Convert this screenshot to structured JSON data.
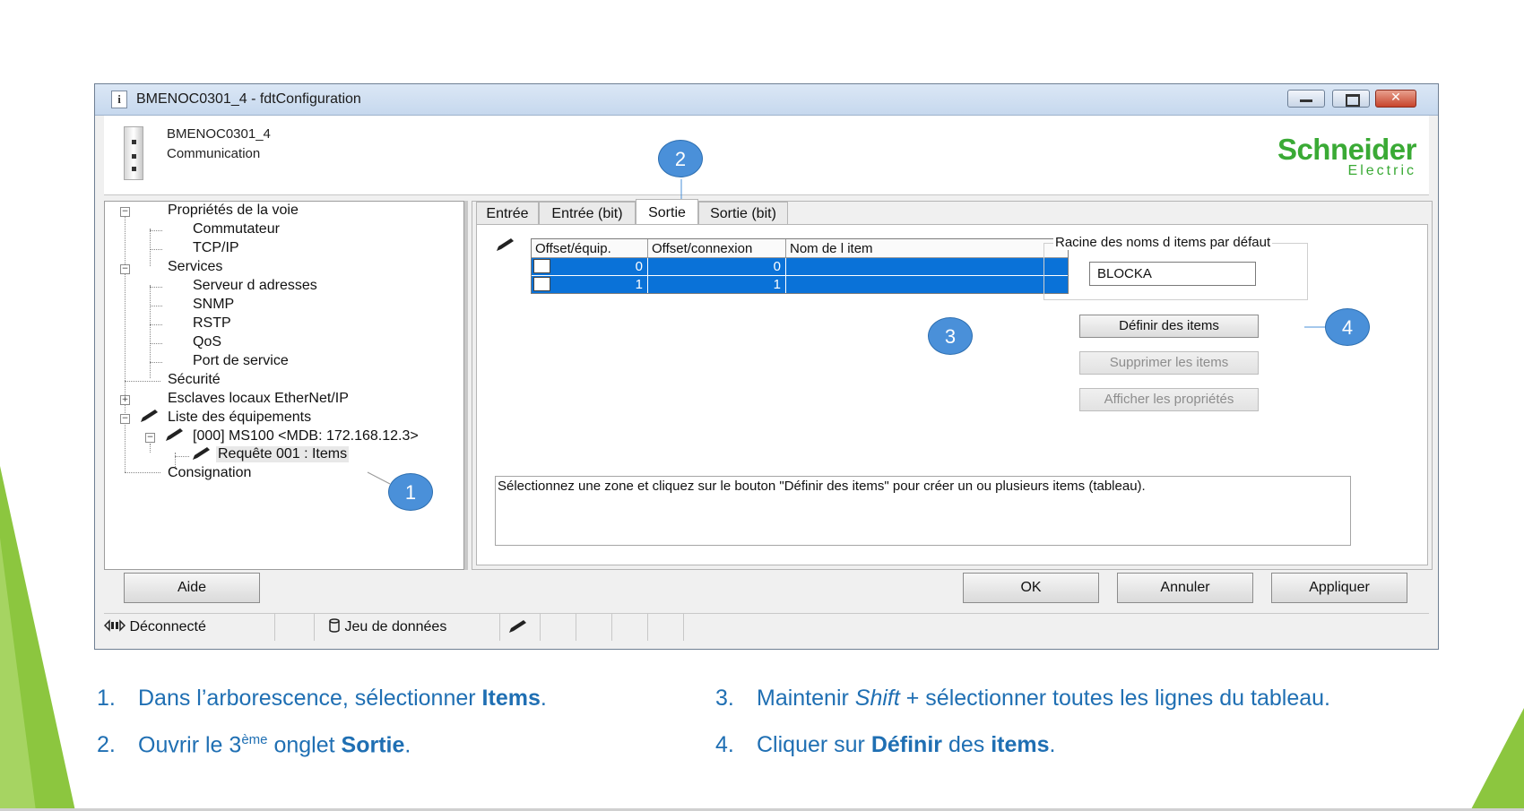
{
  "window": {
    "title": "BMENOC0301_4 - fdtConfiguration",
    "info_icon": "i",
    "close_glyph": "✕"
  },
  "header": {
    "device_name": "BMENOC0301_4",
    "device_subtitle": "Communication",
    "logo_line1": "Schneider",
    "logo_line2": "Electric"
  },
  "tree": {
    "nodes": [
      {
        "label": "Propriétés de la voie"
      },
      {
        "label": "Commutateur"
      },
      {
        "label": "TCP/IP"
      },
      {
        "label": "Services"
      },
      {
        "label": "Serveur d adresses"
      },
      {
        "label": "SNMP"
      },
      {
        "label": "RSTP"
      },
      {
        "label": "QoS"
      },
      {
        "label": "Port de service"
      },
      {
        "label": "Sécurité"
      },
      {
        "label": "Esclaves locaux EtherNet/IP"
      },
      {
        "label": "Liste des équipements"
      },
      {
        "label": "[000] MS100 <MDB: 172.168.12.3>"
      },
      {
        "label": "Requête 001 : Items"
      },
      {
        "label": "Consignation"
      }
    ]
  },
  "tabs": [
    {
      "label": "Entrée"
    },
    {
      "label": "Entrée (bit)"
    },
    {
      "label": "Sortie"
    },
    {
      "label": "Sortie (bit)"
    }
  ],
  "grid": {
    "columns": [
      "Offset/équip.",
      "Offset/connexion",
      "Nom de l item"
    ],
    "rows": [
      {
        "offset_equip": "0",
        "offset_connexion": "0",
        "nom": ""
      },
      {
        "offset_equip": "1",
        "offset_connexion": "1",
        "nom": ""
      }
    ]
  },
  "root_names": {
    "label": "Racine des noms d items par défaut",
    "value": "BLOCKA"
  },
  "actions": {
    "define": "Définir des items",
    "delete": "Supprimer les items",
    "properties": "Afficher les propriétés"
  },
  "message": "Sélectionnez une zone et cliquez sur le bouton \"Définir des items\" pour créer un ou plusieurs items (tableau).",
  "footer": {
    "help": "Aide",
    "ok": "OK",
    "cancel": "Annuler",
    "apply": "Appliquer"
  },
  "status": {
    "connection": "Déconnecté",
    "dataset": "Jeu de données"
  },
  "callouts": [
    "1",
    "2",
    "3",
    "4"
  ],
  "instructions": {
    "step1": {
      "num": "1.",
      "pre": "Dans l’arborescence, sélectionner ",
      "bold": "Items",
      "post": "."
    },
    "step2": {
      "num": "2.",
      "pre": "Ouvrir le 3",
      "sup": "ème",
      "mid": " onglet ",
      "bold": "Sortie",
      "post": "."
    },
    "step3": {
      "num": "3.",
      "pre": "Maintenir ",
      "italic": "Shift",
      "post": " + sélectionner toutes les lignes du tableau."
    },
    "step4": {
      "num": "4.",
      "pre": "Cliquer sur ",
      "bold1": "Définir",
      "mid": " des ",
      "bold2": "items",
      "post": "."
    }
  },
  "colors": {
    "accent_green": "#8cc63f",
    "selection_blue": "#0a72d8",
    "callout_blue": "#4a90d9",
    "instruction_blue": "#1f6fb3",
    "logo_green": "#3aaa35"
  }
}
